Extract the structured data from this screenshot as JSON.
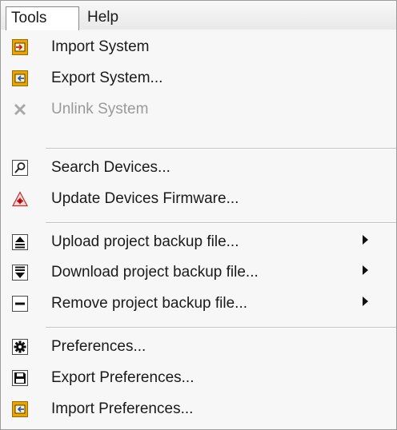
{
  "menubar": {
    "tools": "Tools",
    "help": "Help"
  },
  "items": [
    {
      "label": "Import System",
      "icon": "import-system-icon",
      "enabled": true
    },
    {
      "label": "Export System...",
      "icon": "export-system-icon",
      "enabled": true
    },
    {
      "label": "Unlink System",
      "icon": "unlink-icon",
      "enabled": false
    },
    {
      "label": "Search Devices...",
      "icon": "search-icon",
      "enabled": true
    },
    {
      "label": "Update Devices Firmware...",
      "icon": "firmware-warning-icon",
      "enabled": true
    },
    {
      "label": "Upload project backup file...",
      "icon": "upload-icon",
      "submenu": true
    },
    {
      "label": "Download project backup file...",
      "icon": "download-icon",
      "submenu": true
    },
    {
      "label": "Remove project backup file...",
      "icon": "remove-icon",
      "submenu": true
    },
    {
      "label": "Preferences...",
      "icon": "gear-icon",
      "enabled": true
    },
    {
      "label": "Export Preferences...",
      "icon": "save-icon",
      "enabled": true
    },
    {
      "label": "Import Preferences...",
      "icon": "import-preferences-icon",
      "enabled": true
    }
  ],
  "colors": {
    "icon_orange": "#e8a400",
    "icon_dark": "#222222",
    "disabled_text": "#9a9a9a",
    "warning_red": "#d9201c"
  }
}
